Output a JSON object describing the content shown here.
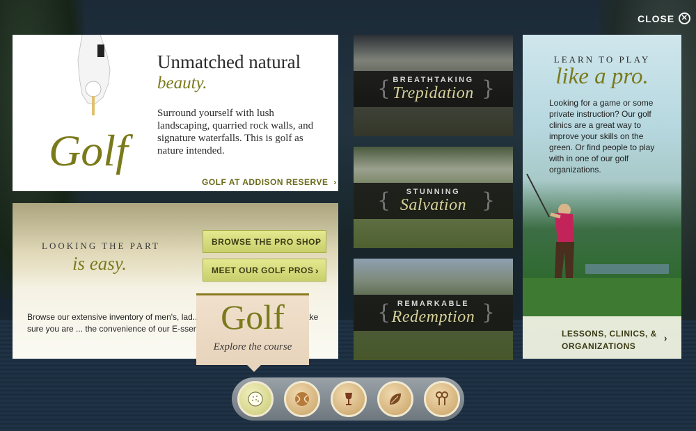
{
  "close_label": "CLOSE",
  "golf_panel": {
    "script_word": "Golf",
    "title": "Unmatched natural",
    "subtitle": "beauty.",
    "body": "Surround yourself with lush landscaping, quarried rock walls, and signature waterfalls. This is golf as nature intended.",
    "link": "GOLF AT ADDISON RESERVE"
  },
  "looking_panel": {
    "heading": "LOOKING THE PART",
    "sub": "is easy.",
    "buttons": [
      "BROWSE THE PRO SHOP",
      "MEET OUR GOLF PROS"
    ],
    "body": "Browse our extensive inventory of men's, lad... friendly pro shop staff will make sure you are ... the convenience of our E-ssential online shoppi..."
  },
  "tiles": [
    {
      "small": "BREATHTAKING",
      "big": "Trepidation"
    },
    {
      "small": "STUNNING",
      "big": "Salvation"
    },
    {
      "small": "REMARKABLE",
      "big": "Redemption"
    }
  ],
  "pro_panel": {
    "learn": "LEARN TO PLAY",
    "pro": "like a pro.",
    "body": "Looking for a game or some private instruction? Our golf clinics are a great way to improve your skills on the green. Or find people to play with in one of our golf organizations.",
    "link_line1": "LESSONS, CLINICS, &",
    "link_line2": "ORGANIZATIONS"
  },
  "tooltip": {
    "title": "Golf",
    "sub": "Explore the course"
  },
  "nav_icons": [
    "golf-ball-icon",
    "tennis-ball-icon",
    "wine-glass-icon",
    "leaf-icon",
    "keys-icon"
  ]
}
